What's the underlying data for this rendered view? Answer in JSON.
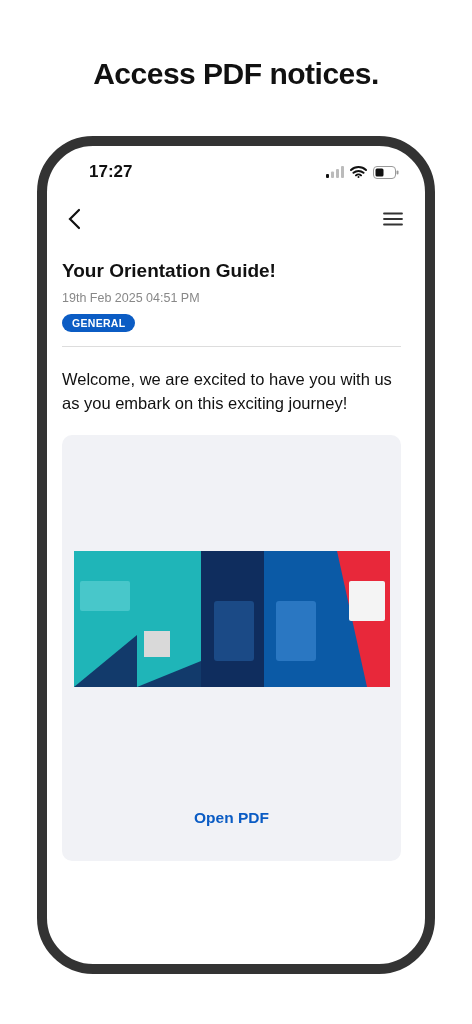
{
  "heading": "Access PDF notices.",
  "status_bar": {
    "time": "17:27"
  },
  "notice": {
    "title": "Your Orientation Guide!",
    "date": "19th Feb 2025 04:51 PM",
    "category": "GENERAL",
    "body": "Welcome, we are excited to have you with us as you embark on this exciting journey!"
  },
  "attachment": {
    "action": "Open PDF"
  }
}
